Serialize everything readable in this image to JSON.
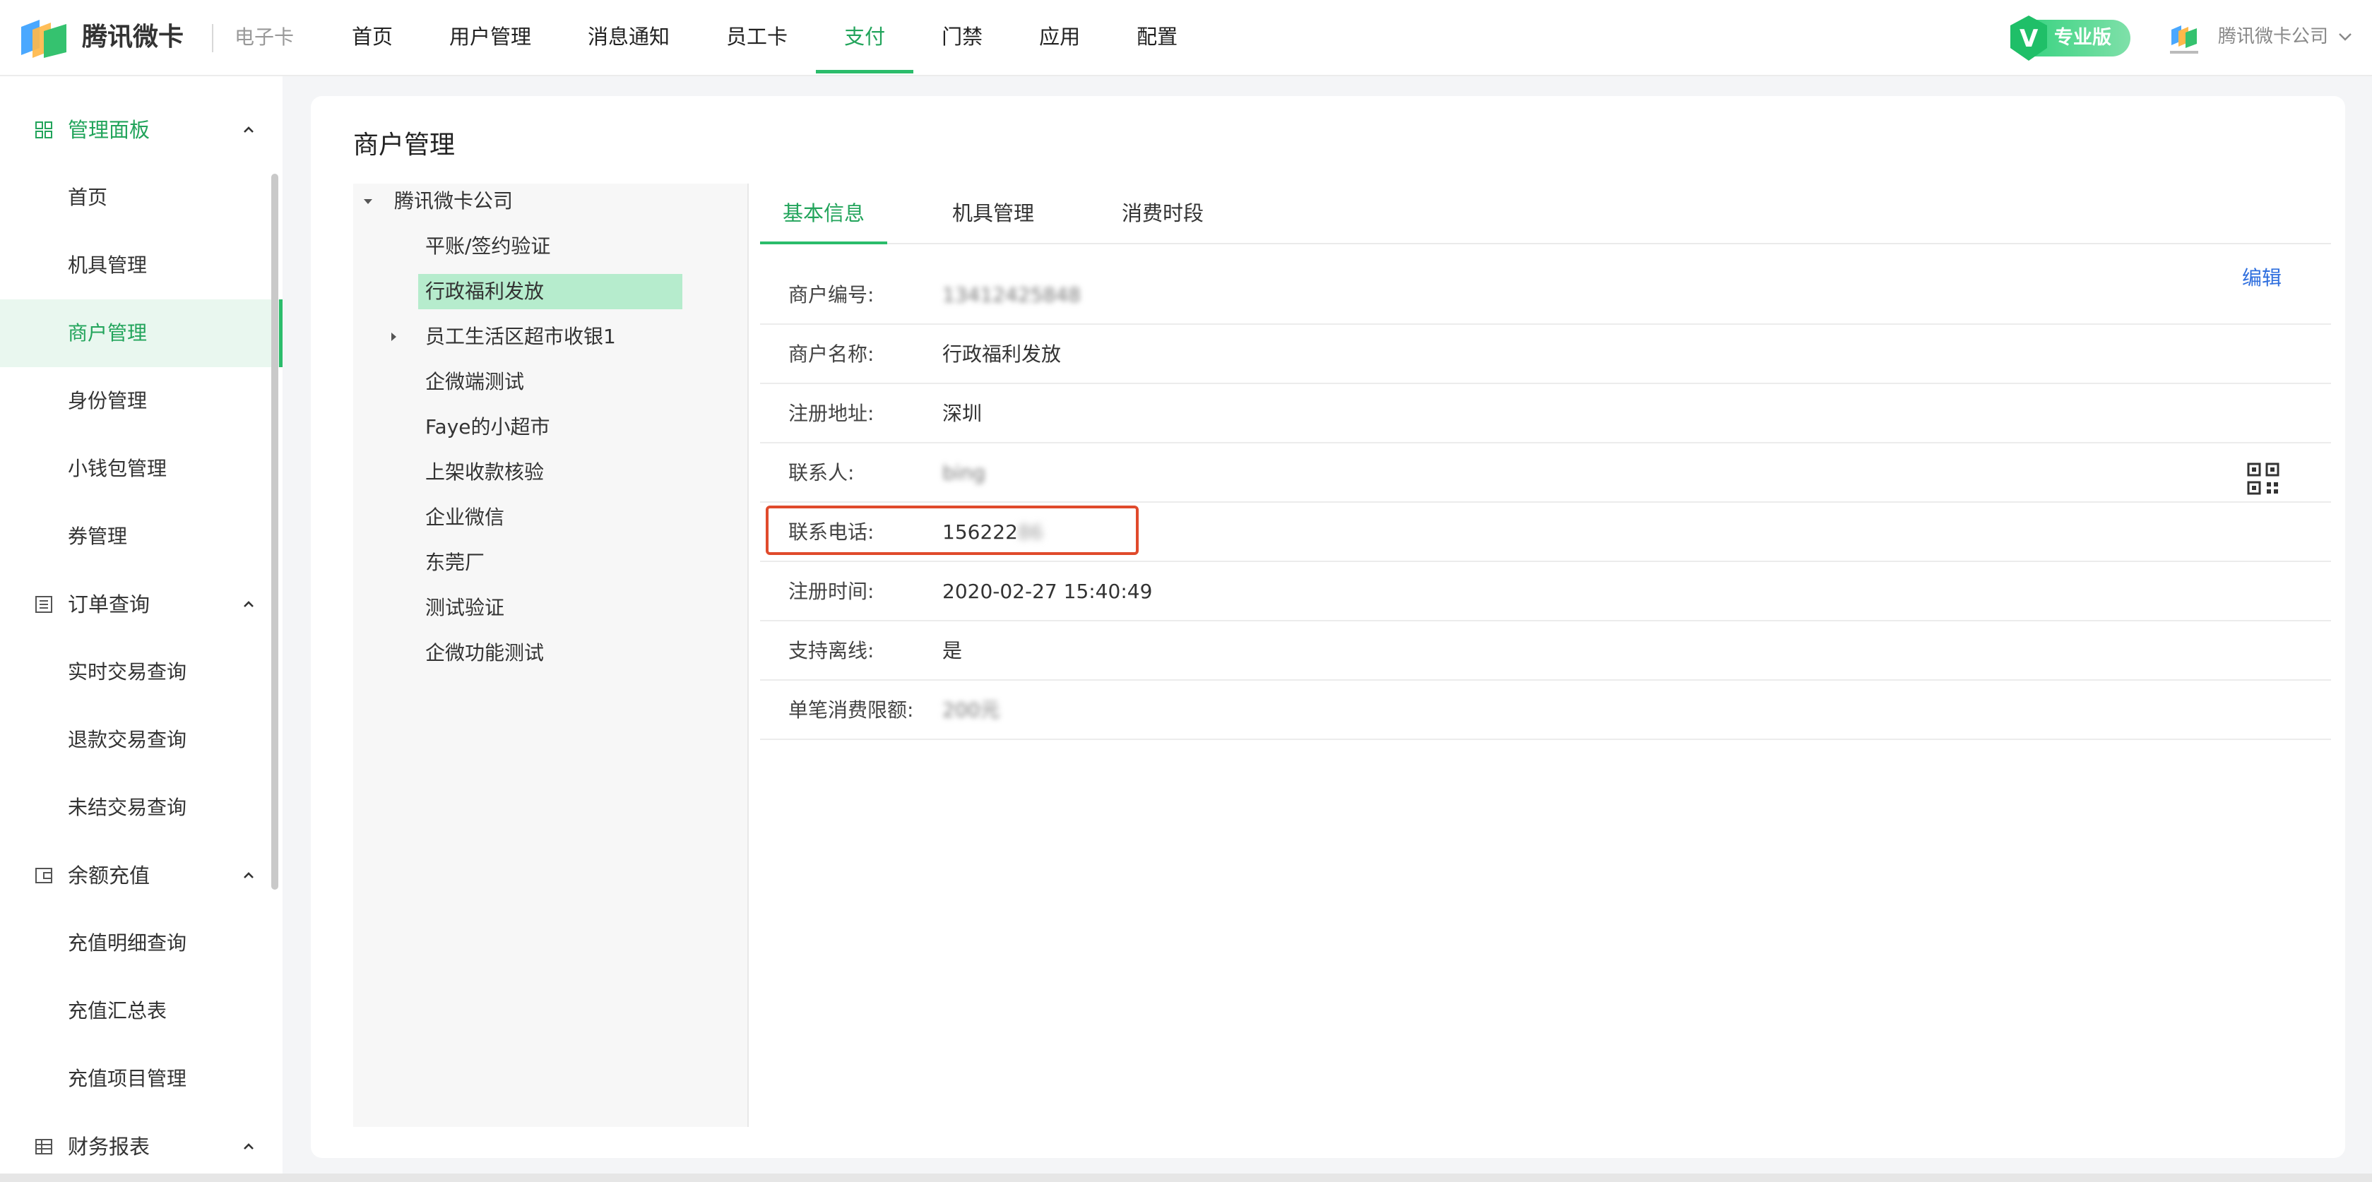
{
  "header": {
    "brand": "腾讯微卡",
    "subtitle": "电子卡",
    "nav": [
      "首页",
      "用户管理",
      "消息通知",
      "员工卡",
      "支付",
      "门禁",
      "应用",
      "配置"
    ],
    "active_nav": "支付",
    "pro_badge": "专业版",
    "company": "腾讯微卡公司"
  },
  "sidebar": {
    "groups": [
      {
        "label": "管理面板",
        "icon": "grid-icon",
        "items": [
          "首页",
          "机具管理",
          "商户管理",
          "身份管理",
          "小钱包管理",
          "券管理"
        ]
      },
      {
        "label": "订单查询",
        "icon": "list-icon",
        "items": [
          "实时交易查询",
          "退款交易查询",
          "未结交易查询"
        ]
      },
      {
        "label": "余额充值",
        "icon": "wallet-icon",
        "items": [
          "充值明细查询",
          "充值汇总表",
          "充值项目管理"
        ]
      },
      {
        "label": "财务报表",
        "icon": "table-icon",
        "items": []
      }
    ],
    "active_item": "商户管理"
  },
  "main": {
    "title": "商户管理",
    "tree": {
      "root": "腾讯微卡公司",
      "children": [
        "平账/签约验证",
        "行政福利发放",
        "员工生活区超市收银1",
        "企微端测试",
        "Faye的小超市",
        "上架收款核验",
        "企业微信",
        "东莞厂",
        "测试验证",
        "企微功能测试"
      ],
      "selected": "行政福利发放"
    },
    "tabs": [
      "基本信息",
      "机具管理",
      "消费时段"
    ],
    "active_tab": "基本信息",
    "edit_label": "编辑",
    "info": [
      {
        "label": "商户编号:",
        "value": "13412425848"
      },
      {
        "label": "商户名称:",
        "value": "行政福利发放"
      },
      {
        "label": "注册地址:",
        "value": "深圳"
      },
      {
        "label": "联系人:",
        "value": "bing"
      },
      {
        "label": "联系电话:",
        "value": "156222",
        "value_tail": "86"
      },
      {
        "label": "注册时间:",
        "value": "2020-02-27 15:40:49"
      },
      {
        "label": "支持离线:",
        "value": "是"
      },
      {
        "label": "单笔消费限额:",
        "value": "200元"
      }
    ],
    "colors": {
      "accent": "#2bbc6b",
      "link": "#2f6fde",
      "highlight": "#e04a2c"
    }
  }
}
